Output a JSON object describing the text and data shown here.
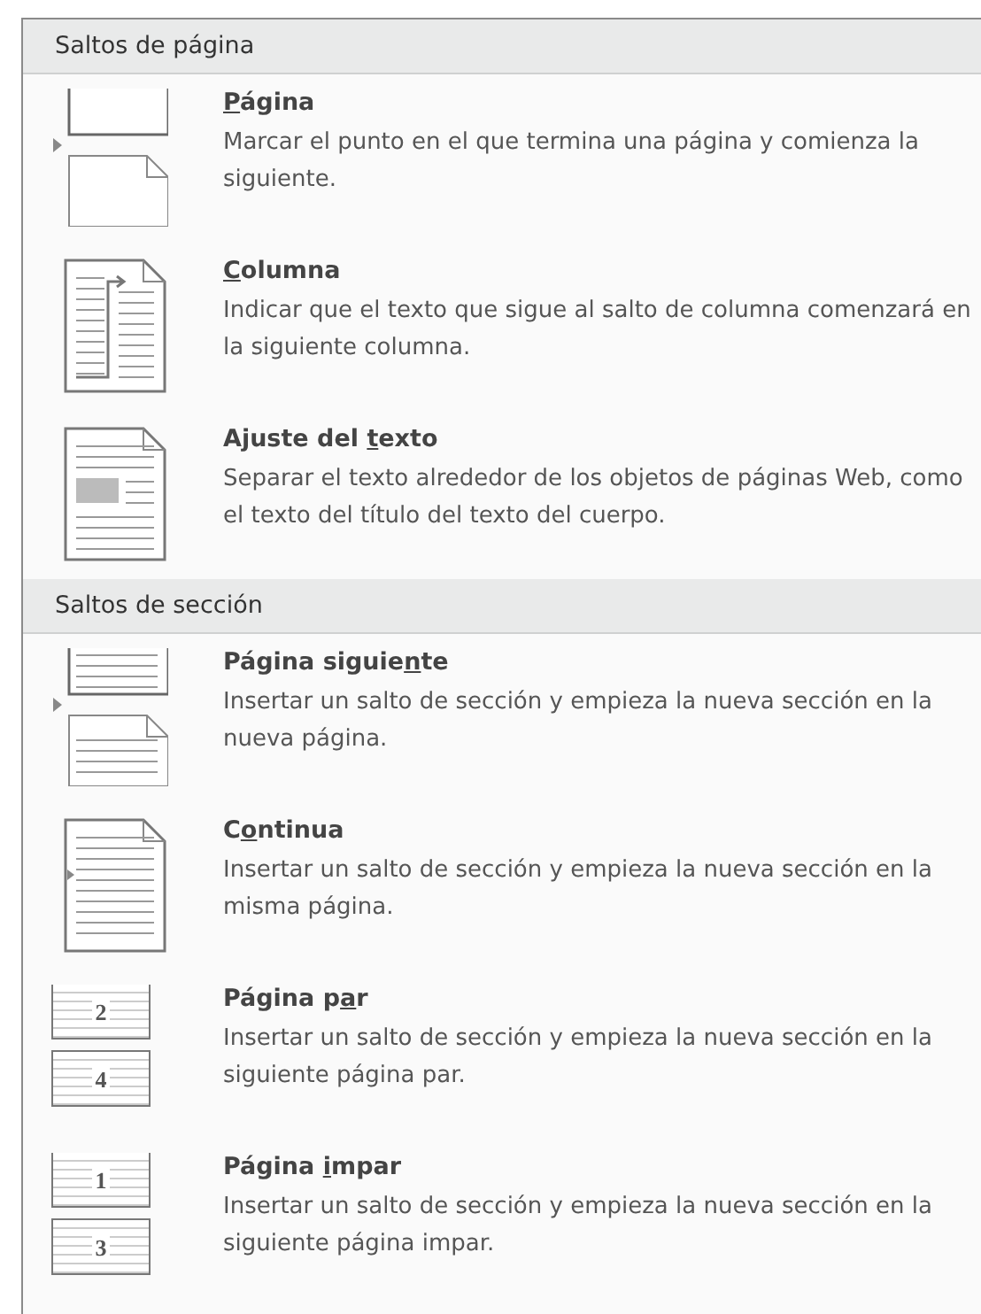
{
  "sections": [
    {
      "title": "Saltos de página",
      "items": [
        {
          "kind": "page",
          "title": {
            "key": "P",
            "post": "ágina"
          },
          "description": "Marcar el punto en el que termina una página y comienza la siguiente."
        },
        {
          "kind": "column",
          "title": {
            "key": "C",
            "post": "olumna"
          },
          "description": "Indicar que el texto que sigue al salto de columna comenzará en la siguiente columna."
        },
        {
          "kind": "wrap",
          "title": {
            "pre": "Ajuste del ",
            "key": "t",
            "post": "exto"
          },
          "description": "Separar el texto alrededor de los objetos de páginas Web, como el texto del título del texto del cuerpo."
        }
      ]
    },
    {
      "title": "Saltos de sección",
      "items": [
        {
          "kind": "next",
          "title": {
            "pre": "Página siguie",
            "key": "n",
            "post": "te"
          },
          "description": "Insertar un salto de sección y empieza la nueva sección en la nueva página."
        },
        {
          "kind": "continuous",
          "title": {
            "pre": "C",
            "key": "o",
            "post": "ntinua"
          },
          "description": "Insertar un salto de sección y empieza la nueva sección en la misma página."
        },
        {
          "kind": "numbered",
          "icon_numbers": [
            "2",
            "4"
          ],
          "title": {
            "pre": "Página p",
            "key": "a",
            "post": "r"
          },
          "description": "Insertar un salto de sección y empieza la nueva sección en la siguiente página par."
        },
        {
          "kind": "numbered",
          "icon_numbers": [
            "1",
            "3"
          ],
          "title": {
            "pre": "Página ",
            "key": "i",
            "post": "mpar"
          },
          "description": "Insertar un salto de sección y empieza la nueva sección en la siguiente página impar."
        }
      ]
    }
  ]
}
